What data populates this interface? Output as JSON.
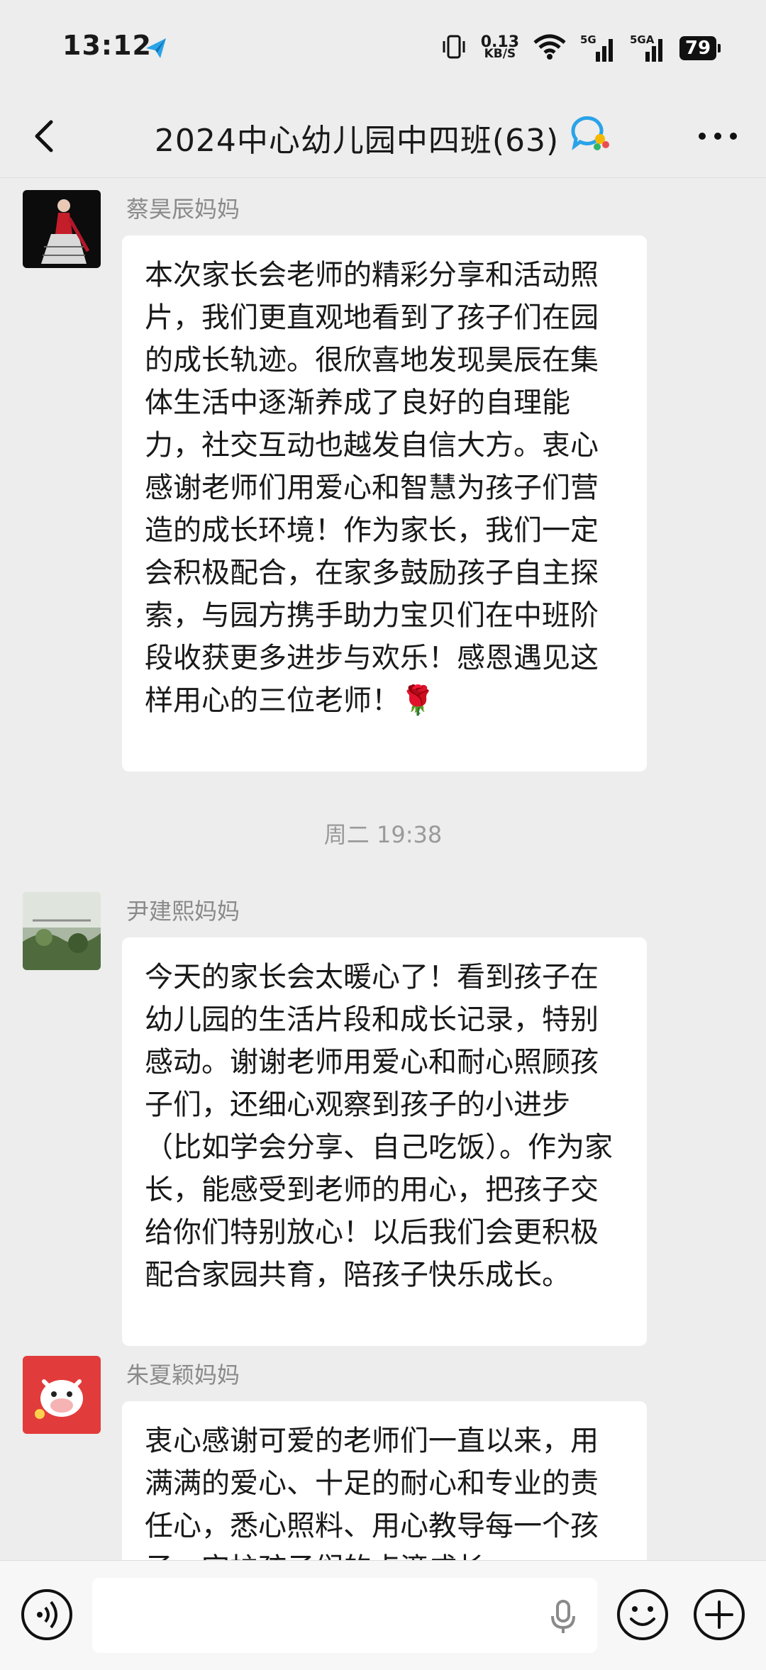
{
  "status_bar": {
    "time": "13:12",
    "net_speed_value": "0.13",
    "net_speed_unit": "KB/S",
    "sim1_label": "5G",
    "sim2_label": "5GA",
    "battery_level": "79"
  },
  "header": {
    "title": "2024中心幼儿园中四班(63)"
  },
  "messages": [
    {
      "sender": "蔡昊辰妈妈",
      "text": "本次家长会老师的精彩分享和活动照片，我们更直观地看到了孩子们在园的成长轨迹。很欣喜地发现昊辰在集体生活中逐渐养成了良好的自理能力，社交互动也越发自信大方。衷心感谢老师们用爱心和智慧为孩子们营造的成长环境！作为家长，我们一定会积极配合，在家多鼓励孩子自主探索，与园方携手助力宝贝们在中班阶段收获更多进步与欢乐！感恩遇见这样用心的三位老师！🌹"
    },
    {
      "sender": "尹建熙妈妈",
      "text": "今天的家长会太暖心了！看到孩子在幼儿园的生活片段和成长记录，特别感动。谢谢老师用爱心和耐心照顾孩子们，还细心观察到孩子的小进步（比如学会分享、自己吃饭）。作为家长，能感受到老师的用心，把孩子交给你们特别放心！以后我们会更积极配合家园共育，陪孩子快乐成长。"
    },
    {
      "sender": "朱夏颖妈妈",
      "text": "衷心感谢可爱的老师们一直以来，用满满的爱心、十足的耐心和专业的责任心，悉心照料、用心教导每一个孩子，守护孩子们的点滴成长"
    }
  ],
  "timestamp": "周二 19:38",
  "colors": {
    "background": "#ededed",
    "bubble": "#ffffff",
    "secondary_text": "#8a8a8a"
  }
}
